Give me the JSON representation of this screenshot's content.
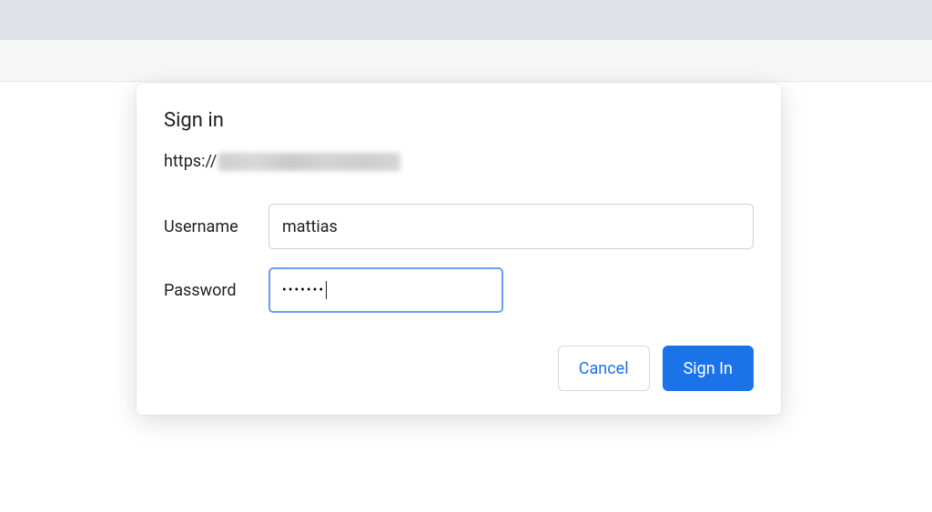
{
  "dialog": {
    "title": "Sign in",
    "url_protocol": "https://",
    "username_label": "Username",
    "username_value": "mattias",
    "password_label": "Password",
    "password_masked": "•••••••",
    "cancel_label": "Cancel",
    "signin_label": "Sign In"
  }
}
